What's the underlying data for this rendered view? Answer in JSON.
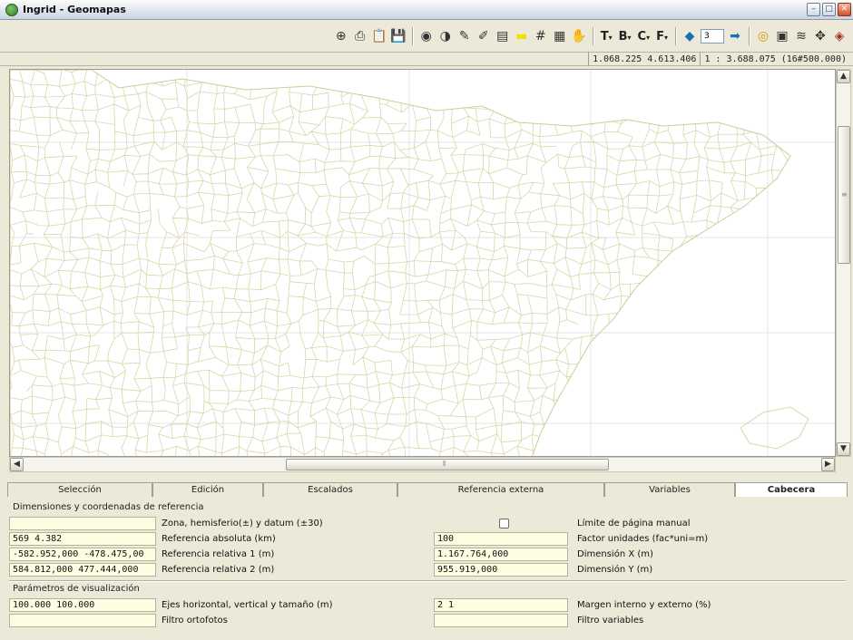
{
  "window": {
    "title": "Ingrid - Geomapas",
    "controls": [
      "minimize",
      "maximize",
      "close"
    ]
  },
  "toolbar": {
    "dropdowns": [
      "T",
      "B",
      "C",
      "F"
    ],
    "page_value": "3",
    "icons": [
      "zoom-icon",
      "print-icon",
      "clipboard-icon",
      "save-disk-icon",
      "eye-icon",
      "contrast-icon",
      "brush-icon",
      "brush-check-icon",
      "layer-select-icon",
      "color-fill-icon",
      "grid-hash-icon",
      "document-icon",
      "hand-icon",
      "prev-arrow-icon",
      "next-arrow-icon",
      "target-icon",
      "grid-table-icon",
      "layers-icon",
      "move-icon",
      "book-icon"
    ]
  },
  "coords": {
    "position": "1.068.225  4.613.406",
    "scale": "1 : 3.688.075 (16#500.000)"
  },
  "tabs": [
    {
      "label": "Selección",
      "active": false
    },
    {
      "label": "Edición",
      "active": false
    },
    {
      "label": "Escalados",
      "active": false
    },
    {
      "label": "Referencia externa",
      "active": false
    },
    {
      "label": "Variables",
      "active": false
    },
    {
      "label": "Cabecera",
      "active": true
    }
  ],
  "panel": {
    "section1": "Dimensiones y coordenadas de referencia",
    "section2": "Parámetros de visualización",
    "rows": {
      "zona_value": "",
      "zona_label": "Zona, hemisferio(±) y datum (±30)",
      "limite_label": "Límite de página manual",
      "ref_abs_value": "569 4.382",
      "ref_abs_label": "Referencia absoluta (km)",
      "factor_value": "100",
      "factor_label": "Factor unidades (fac*uni=m)",
      "ref_rel1_value": "-582.952,000 -478.475,00",
      "ref_rel1_label": "Referencia relativa 1 (m)",
      "dimx_value": "1.167.764,000",
      "dimx_label": "Dimensión X (m)",
      "ref_rel2_value": "584.812,000 477.444,000",
      "ref_rel2_label": "Referencia relativa 2 (m)",
      "dimy_value": "955.919,000",
      "dimy_label": "Dimensión Y (m)",
      "ejes_value": "100.000 100.000",
      "ejes_label": "Ejes horizontal, vertical y tamaño (m)",
      "margen_value": "2 1",
      "margen_label": "Margen interno y externo (%)",
      "orto_value": "",
      "orto_label": "Filtro ortofotos",
      "filtro_var_value": "",
      "filtro_var_label": "Filtro variables"
    }
  },
  "colors": {
    "map_lines": "#d9d6a8",
    "field_bg": "#fdfde2",
    "chrome": "#ece9d8"
  }
}
